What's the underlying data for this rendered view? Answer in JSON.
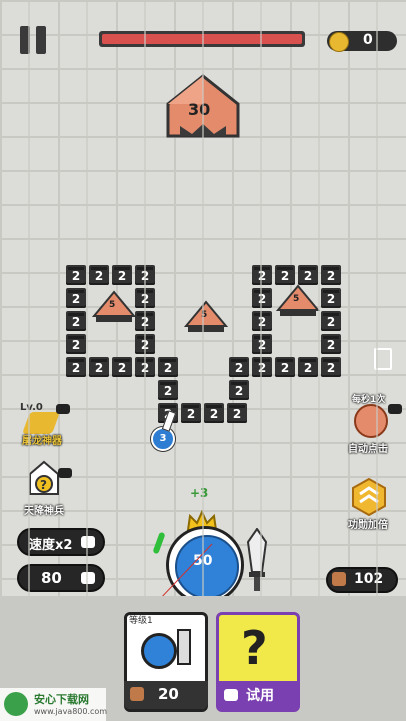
{
  "hud": {
    "coins": "0",
    "boss_hp": "30"
  },
  "blocks": {
    "label": "2",
    "tent_label": "5"
  },
  "ball": {
    "label": "3"
  },
  "left_panel": {
    "skill1_level": "Lv.0",
    "skill1_label": "屠龙神器",
    "skill2_label": "天降神兵",
    "speed_label": "速度x2",
    "balls_count": "80"
  },
  "right_panel": {
    "auto_top": "每秒1次",
    "auto_label": "自动点击",
    "buff_label": "功勋加倍",
    "medal_count": "102"
  },
  "cannon": {
    "plus": "+3",
    "value": "50"
  },
  "shop": {
    "card1_tag": "等级1",
    "card1_price": "20",
    "card2_label": "试用",
    "card2_icon": "?"
  },
  "watermark": {
    "title": "安心下载网",
    "url": "www.java800.com"
  }
}
